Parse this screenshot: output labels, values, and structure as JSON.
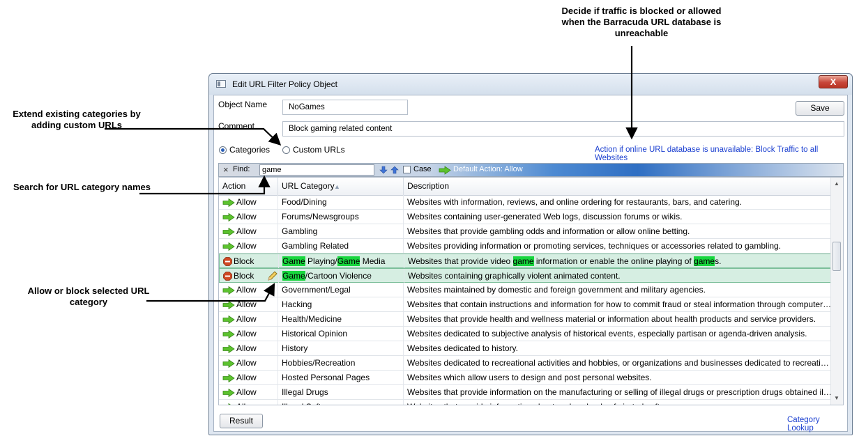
{
  "annotations": {
    "top": "Decide if traffic is blocked or allowed when the Barracuda URL database is unreachable",
    "extend": "Extend existing categories by adding custom URLs",
    "search": "Search for URL category names",
    "allow_block": "Allow or block selected URL category"
  },
  "window": {
    "title": "Edit URL Filter Policy Object",
    "close_label": "X"
  },
  "form": {
    "object_name_label": "Object Name",
    "object_name_value": "NoGames",
    "comment_label": "Comment",
    "comment_value": "Block gaming related content",
    "save_label": "Save",
    "radio_categories": "Categories",
    "radio_custom": "Custom URLs",
    "action_link": "Action if online URL database is unavailable: Block Traffic to all Websites"
  },
  "findbar": {
    "close": "×",
    "find_label": "Find:",
    "find_value": "game",
    "case_label": "Case",
    "default_action": "Default Action: Allow"
  },
  "table": {
    "headers": [
      "Action",
      "URL Category",
      "Description"
    ],
    "rows": [
      {
        "action": "Allow",
        "category": "Food/Dining",
        "description": "Websites with information, reviews, and online ordering for restaurants, bars, and catering."
      },
      {
        "action": "Allow",
        "category": "Forums/Newsgroups",
        "description": "Websites containing user-generated Web logs, discussion forums or wikis."
      },
      {
        "action": "Allow",
        "category": "Gambling",
        "description": "Websites that provide gambling odds and information or allow online betting."
      },
      {
        "action": "Allow",
        "category": "Gambling Related",
        "description": "Websites providing information or promoting services, techniques or accessories related to gambling."
      },
      {
        "action": "Block",
        "category": "Game Playing/Game Media",
        "description": "Websites that provide video game information or enable the online playing of games."
      },
      {
        "action": "Block",
        "category": "Game/Cartoon Violence",
        "description": "Websites containing graphically violent animated content."
      },
      {
        "action": "Allow",
        "category": "Government/Legal",
        "description": "Websites maintained by domestic and foreign government and military agencies."
      },
      {
        "action": "Allow",
        "category": "Hacking",
        "description": "Websites that contain instructions and information for how to commit fraud or steal information through computer security v..."
      },
      {
        "action": "Allow",
        "category": "Health/Medicine",
        "description": "Websites that provide health and wellness material or information about health products and service providers."
      },
      {
        "action": "Allow",
        "category": "Historical Opinion",
        "description": "Websites dedicated to subjective analysis of historical events, especially partisan or agenda-driven analysis."
      },
      {
        "action": "Allow",
        "category": "History",
        "description": "Websites dedicated to history."
      },
      {
        "action": "Allow",
        "category": "Hobbies/Recreation",
        "description": "Websites dedicated to recreational activities and hobbies, or organizations and businesses dedicated to recreation, such a..."
      },
      {
        "action": "Allow",
        "category": "Hosted Personal Pages",
        "description": "Websites which allow users to design and post personal websites."
      },
      {
        "action": "Allow",
        "category": "Illegal Drugs",
        "description": "Websites that provide information on the manufacturing or selling of illegal drugs or prescription drugs obtained illegally."
      },
      {
        "action": "Allow",
        "category": "Illegal Software",
        "description": "Websites that provide information about or downloads of pirated software."
      }
    ]
  },
  "footer": {
    "result_label": "Result",
    "lookup_link": "Category Lookup"
  },
  "colors": {
    "highlight": "#18d63e",
    "blocked_row": "#d6eee2",
    "link": "#1b3fd0",
    "allow_arrow": "#5cc22e",
    "block_stop": "#d04a24"
  }
}
